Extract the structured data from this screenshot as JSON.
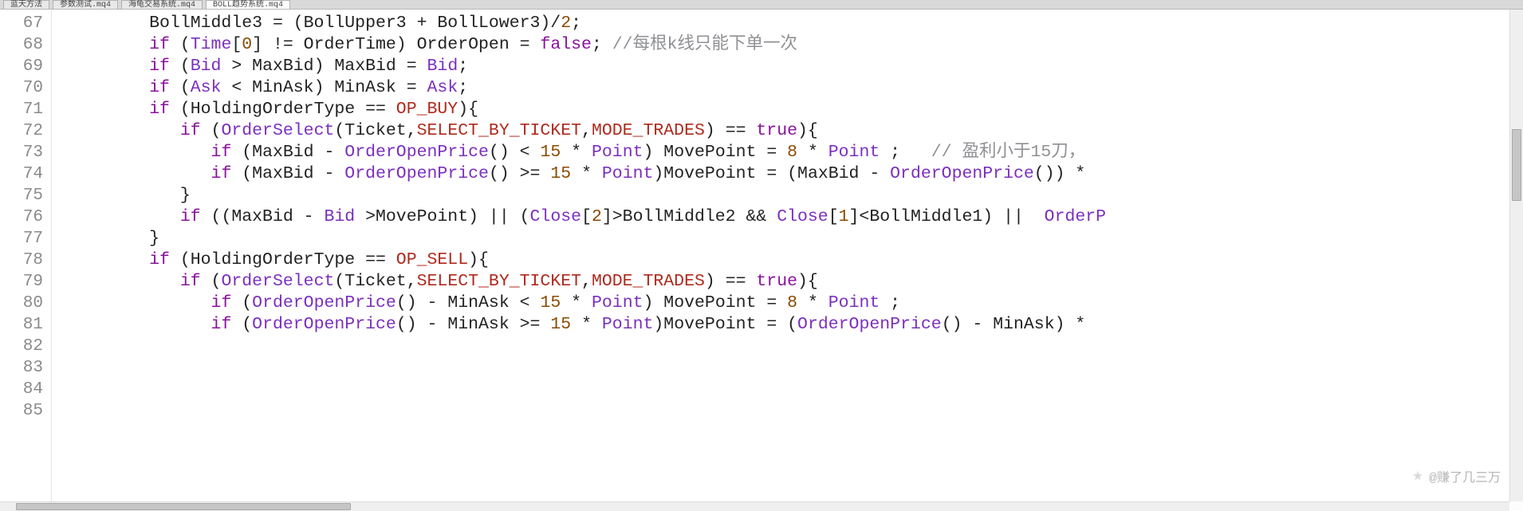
{
  "tabs": {
    "items": [
      {
        "label": "蓝天方法"
      },
      {
        "label": "参数测试.mq4"
      },
      {
        "label": "海龟交易系统.mq4"
      },
      {
        "label": "BOLL趋势系统.mq4"
      }
    ],
    "active_index": 3
  },
  "editor": {
    "line_start": 67,
    "lines": [
      {
        "n": 67,
        "segs": [
          {
            "t": "         BollMiddle3 = (BollUpper3 + BollLower3)/",
            "c": "pn"
          },
          {
            "t": "2",
            "c": "num"
          },
          {
            "t": ";",
            "c": "pn"
          }
        ]
      },
      {
        "n": 68,
        "segs": [
          {
            "t": "",
            "c": "pn"
          }
        ]
      },
      {
        "n": 69,
        "segs": [
          {
            "t": "         ",
            "c": "pn"
          },
          {
            "t": "if",
            "c": "kw"
          },
          {
            "t": " (",
            "c": "pn"
          },
          {
            "t": "Time",
            "c": "glob"
          },
          {
            "t": "[",
            "c": "pn"
          },
          {
            "t": "0",
            "c": "num"
          },
          {
            "t": "] != OrderTime) OrderOpen = ",
            "c": "pn"
          },
          {
            "t": "false",
            "c": "kw"
          },
          {
            "t": "; ",
            "c": "pn"
          },
          {
            "t": "//每根k线只能下单一次",
            "c": "cmt"
          }
        ]
      },
      {
        "n": 70,
        "segs": [
          {
            "t": "",
            "c": "pn"
          }
        ]
      },
      {
        "n": 71,
        "segs": [
          {
            "t": "         ",
            "c": "pn"
          },
          {
            "t": "if",
            "c": "kw"
          },
          {
            "t": " (",
            "c": "pn"
          },
          {
            "t": "Bid",
            "c": "glob"
          },
          {
            "t": " > MaxBid) MaxBid = ",
            "c": "pn"
          },
          {
            "t": "Bid",
            "c": "glob"
          },
          {
            "t": ";",
            "c": "pn"
          }
        ]
      },
      {
        "n": 72,
        "segs": [
          {
            "t": "         ",
            "c": "pn"
          },
          {
            "t": "if",
            "c": "kw"
          },
          {
            "t": " (",
            "c": "pn"
          },
          {
            "t": "Ask",
            "c": "glob"
          },
          {
            "t": " < MinAsk) MinAsk = ",
            "c": "pn"
          },
          {
            "t": "Ask",
            "c": "glob"
          },
          {
            "t": ";",
            "c": "pn"
          }
        ]
      },
      {
        "n": 73,
        "segs": [
          {
            "t": "",
            "c": "pn"
          }
        ]
      },
      {
        "n": 74,
        "segs": [
          {
            "t": "         ",
            "c": "pn"
          },
          {
            "t": "if",
            "c": "kw"
          },
          {
            "t": " (HoldingOrderType == ",
            "c": "pn"
          },
          {
            "t": "OP_BUY",
            "c": "const"
          },
          {
            "t": "){",
            "c": "pn"
          }
        ]
      },
      {
        "n": 75,
        "segs": [
          {
            "t": "            ",
            "c": "pn"
          },
          {
            "t": "if",
            "c": "kw"
          },
          {
            "t": " (",
            "c": "pn"
          },
          {
            "t": "OrderSelect",
            "c": "fn"
          },
          {
            "t": "(Ticket,",
            "c": "pn"
          },
          {
            "t": "SELECT_BY_TICKET",
            "c": "const"
          },
          {
            "t": ",",
            "c": "pn"
          },
          {
            "t": "MODE_TRADES",
            "c": "const"
          },
          {
            "t": ") == ",
            "c": "pn"
          },
          {
            "t": "true",
            "c": "kw"
          },
          {
            "t": "){",
            "c": "pn"
          }
        ]
      },
      {
        "n": 76,
        "segs": [
          {
            "t": "               ",
            "c": "pn"
          },
          {
            "t": "if",
            "c": "kw"
          },
          {
            "t": " (MaxBid - ",
            "c": "pn"
          },
          {
            "t": "OrderOpenPrice",
            "c": "fn"
          },
          {
            "t": "() < ",
            "c": "pn"
          },
          {
            "t": "15",
            "c": "num"
          },
          {
            "t": " * ",
            "c": "pn"
          },
          {
            "t": "Point",
            "c": "glob"
          },
          {
            "t": ") MovePoint = ",
            "c": "pn"
          },
          {
            "t": "8",
            "c": "num"
          },
          {
            "t": " * ",
            "c": "pn"
          },
          {
            "t": "Point",
            "c": "glob"
          },
          {
            "t": " ;   ",
            "c": "pn"
          },
          {
            "t": "// 盈利小于15刀，",
            "c": "cmt"
          }
        ]
      },
      {
        "n": 77,
        "segs": [
          {
            "t": "               ",
            "c": "pn"
          },
          {
            "t": "if",
            "c": "kw"
          },
          {
            "t": " (MaxBid - ",
            "c": "pn"
          },
          {
            "t": "OrderOpenPrice",
            "c": "fn"
          },
          {
            "t": "() >= ",
            "c": "pn"
          },
          {
            "t": "15",
            "c": "num"
          },
          {
            "t": " * ",
            "c": "pn"
          },
          {
            "t": "Point",
            "c": "glob"
          },
          {
            "t": ")MovePoint = (MaxBid - ",
            "c": "pn"
          },
          {
            "t": "OrderOpenPrice",
            "c": "fn"
          },
          {
            "t": "()) * ",
            "c": "pn"
          }
        ]
      },
      {
        "n": 78,
        "segs": [
          {
            "t": "            }",
            "c": "pn"
          }
        ]
      },
      {
        "n": 79,
        "segs": [
          {
            "t": "            ",
            "c": "pn"
          },
          {
            "t": "if",
            "c": "kw"
          },
          {
            "t": " ((MaxBid - ",
            "c": "pn"
          },
          {
            "t": "Bid",
            "c": "glob"
          },
          {
            "t": " >MovePoint) || (",
            "c": "pn"
          },
          {
            "t": "Close",
            "c": "glob"
          },
          {
            "t": "[",
            "c": "pn"
          },
          {
            "t": "2",
            "c": "num"
          },
          {
            "t": "]>BollMiddle2 && ",
            "c": "pn"
          },
          {
            "t": "Close",
            "c": "glob"
          },
          {
            "t": "[",
            "c": "pn"
          },
          {
            "t": "1",
            "c": "num"
          },
          {
            "t": "]<BollMiddle1) ||  ",
            "c": "pn"
          },
          {
            "t": "OrderP",
            "c": "fn"
          }
        ]
      },
      {
        "n": 80,
        "segs": [
          {
            "t": "         }",
            "c": "pn"
          }
        ]
      },
      {
        "n": 81,
        "segs": [
          {
            "t": "",
            "c": "pn"
          }
        ]
      },
      {
        "n": 82,
        "segs": [
          {
            "t": "         ",
            "c": "pn"
          },
          {
            "t": "if",
            "c": "kw"
          },
          {
            "t": " (HoldingOrderType == ",
            "c": "pn"
          },
          {
            "t": "OP_SELL",
            "c": "const"
          },
          {
            "t": "){",
            "c": "pn"
          }
        ]
      },
      {
        "n": 83,
        "segs": [
          {
            "t": "            ",
            "c": "pn"
          },
          {
            "t": "if",
            "c": "kw"
          },
          {
            "t": " (",
            "c": "pn"
          },
          {
            "t": "OrderSelect",
            "c": "fn"
          },
          {
            "t": "(Ticket,",
            "c": "pn"
          },
          {
            "t": "SELECT_BY_TICKET",
            "c": "const"
          },
          {
            "t": ",",
            "c": "pn"
          },
          {
            "t": "MODE_TRADES",
            "c": "const"
          },
          {
            "t": ") == ",
            "c": "pn"
          },
          {
            "t": "true",
            "c": "kw"
          },
          {
            "t": "){",
            "c": "pn"
          }
        ]
      },
      {
        "n": 84,
        "segs": [
          {
            "t": "               ",
            "c": "pn"
          },
          {
            "t": "if",
            "c": "kw"
          },
          {
            "t": " (",
            "c": "pn"
          },
          {
            "t": "OrderOpenPrice",
            "c": "fn"
          },
          {
            "t": "() - MinAsk < ",
            "c": "pn"
          },
          {
            "t": "15",
            "c": "num"
          },
          {
            "t": " * ",
            "c": "pn"
          },
          {
            "t": "Point",
            "c": "glob"
          },
          {
            "t": ") MovePoint = ",
            "c": "pn"
          },
          {
            "t": "8",
            "c": "num"
          },
          {
            "t": " * ",
            "c": "pn"
          },
          {
            "t": "Point",
            "c": "glob"
          },
          {
            "t": " ;",
            "c": "pn"
          }
        ]
      },
      {
        "n": 85,
        "segs": [
          {
            "t": "               ",
            "c": "pn"
          },
          {
            "t": "if",
            "c": "kw"
          },
          {
            "t": " (",
            "c": "pn"
          },
          {
            "t": "OrderOpenPrice",
            "c": "fn"
          },
          {
            "t": "() - MinAsk >= ",
            "c": "pn"
          },
          {
            "t": "15",
            "c": "num"
          },
          {
            "t": " * ",
            "c": "pn"
          },
          {
            "t": "Point",
            "c": "glob"
          },
          {
            "t": ")MovePoint = (",
            "c": "pn"
          },
          {
            "t": "OrderOpenPrice",
            "c": "fn"
          },
          {
            "t": "() - MinAsk) * ",
            "c": "pn"
          }
        ]
      }
    ]
  },
  "watermark": {
    "text": "@赚了几三万"
  },
  "colors": {
    "keyword": "#8a129c",
    "number": "#8a4a00",
    "function": "#7b2fbf",
    "global": "#7b2fbf",
    "constant": "#b02a1d",
    "comment": "#8f9094",
    "plain": "#222222",
    "gutter": "#8a8a8a",
    "background": "#ffffff"
  }
}
